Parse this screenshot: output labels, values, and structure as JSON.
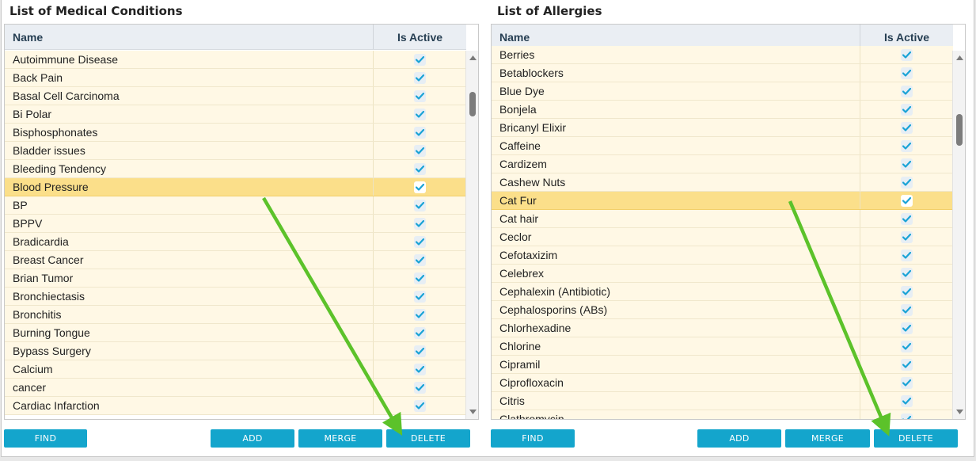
{
  "left": {
    "title": "List of Medical Conditions",
    "columns": {
      "name": "Name",
      "active": "Is Active"
    },
    "rows": [
      {
        "name": "Autoimmune Disease",
        "active": true,
        "selected": false
      },
      {
        "name": "Back Pain",
        "active": true,
        "selected": false
      },
      {
        "name": "Basal Cell Carcinoma",
        "active": true,
        "selected": false
      },
      {
        "name": "Bi Polar",
        "active": true,
        "selected": false
      },
      {
        "name": "Bisphosphonates",
        "active": true,
        "selected": false
      },
      {
        "name": "Bladder issues",
        "active": true,
        "selected": false
      },
      {
        "name": "Bleeding Tendency",
        "active": true,
        "selected": false
      },
      {
        "name": "Blood Pressure",
        "active": true,
        "selected": true
      },
      {
        "name": "BP",
        "active": true,
        "selected": false
      },
      {
        "name": "BPPV",
        "active": true,
        "selected": false
      },
      {
        "name": "Bradicardia",
        "active": true,
        "selected": false
      },
      {
        "name": "Breast Cancer",
        "active": true,
        "selected": false
      },
      {
        "name": "Brian Tumor",
        "active": true,
        "selected": false
      },
      {
        "name": "Bronchiectasis",
        "active": true,
        "selected": false
      },
      {
        "name": "Bronchitis",
        "active": true,
        "selected": false
      },
      {
        "name": "Burning Tongue",
        "active": true,
        "selected": false
      },
      {
        "name": "Bypass Surgery",
        "active": true,
        "selected": false
      },
      {
        "name": "Calcium",
        "active": true,
        "selected": false
      },
      {
        "name": "cancer",
        "active": true,
        "selected": false
      },
      {
        "name": "Cardiac Infarction",
        "active": true,
        "selected": false
      }
    ],
    "buttons": {
      "find": "FIND",
      "add": "ADD",
      "merge": "MERGE",
      "delete": "DELETE"
    }
  },
  "right": {
    "title": "List of Allergies",
    "columns": {
      "name": "Name",
      "active": "Is Active"
    },
    "rows": [
      {
        "name": "Berries",
        "active": true,
        "selected": false
      },
      {
        "name": "Betablockers",
        "active": true,
        "selected": false
      },
      {
        "name": "Blue Dye",
        "active": true,
        "selected": false
      },
      {
        "name": "Bonjela",
        "active": true,
        "selected": false
      },
      {
        "name": "Bricanyl Elixir",
        "active": true,
        "selected": false
      },
      {
        "name": "Caffeine",
        "active": true,
        "selected": false
      },
      {
        "name": "Cardizem",
        "active": true,
        "selected": false
      },
      {
        "name": "Cashew Nuts",
        "active": true,
        "selected": false
      },
      {
        "name": "Cat Fur",
        "active": true,
        "selected": true
      },
      {
        "name": "Cat hair",
        "active": true,
        "selected": false
      },
      {
        "name": "Ceclor",
        "active": true,
        "selected": false
      },
      {
        "name": "Cefotaxizim",
        "active": true,
        "selected": false
      },
      {
        "name": "Celebrex",
        "active": true,
        "selected": false
      },
      {
        "name": "Cephalexin (Antibiotic)",
        "active": true,
        "selected": false
      },
      {
        "name": "Cephalosporins (ABs)",
        "active": true,
        "selected": false
      },
      {
        "name": "Chlorhexadine",
        "active": true,
        "selected": false
      },
      {
        "name": "Chlorine",
        "active": true,
        "selected": false
      },
      {
        "name": "Cipramil",
        "active": true,
        "selected": false
      },
      {
        "name": "Ciprofloxacin",
        "active": true,
        "selected": false
      },
      {
        "name": "Citris",
        "active": true,
        "selected": false
      },
      {
        "name": "Clathromycin",
        "active": true,
        "selected": false
      }
    ],
    "buttons": {
      "find": "FIND",
      "add": "ADD",
      "merge": "MERGE",
      "delete": "DELETE"
    }
  },
  "colors": {
    "button": "#14a5cc",
    "row": "#fff8e5",
    "row_selected": "#fbdf8a",
    "check": "#1aa3d6",
    "arrow": "#5cc22a"
  },
  "icons": {
    "checkbox": "check-icon",
    "scroll_up": "chevron-up-icon",
    "scroll_down": "chevron-down-icon",
    "annotation": "arrow-annotation"
  }
}
